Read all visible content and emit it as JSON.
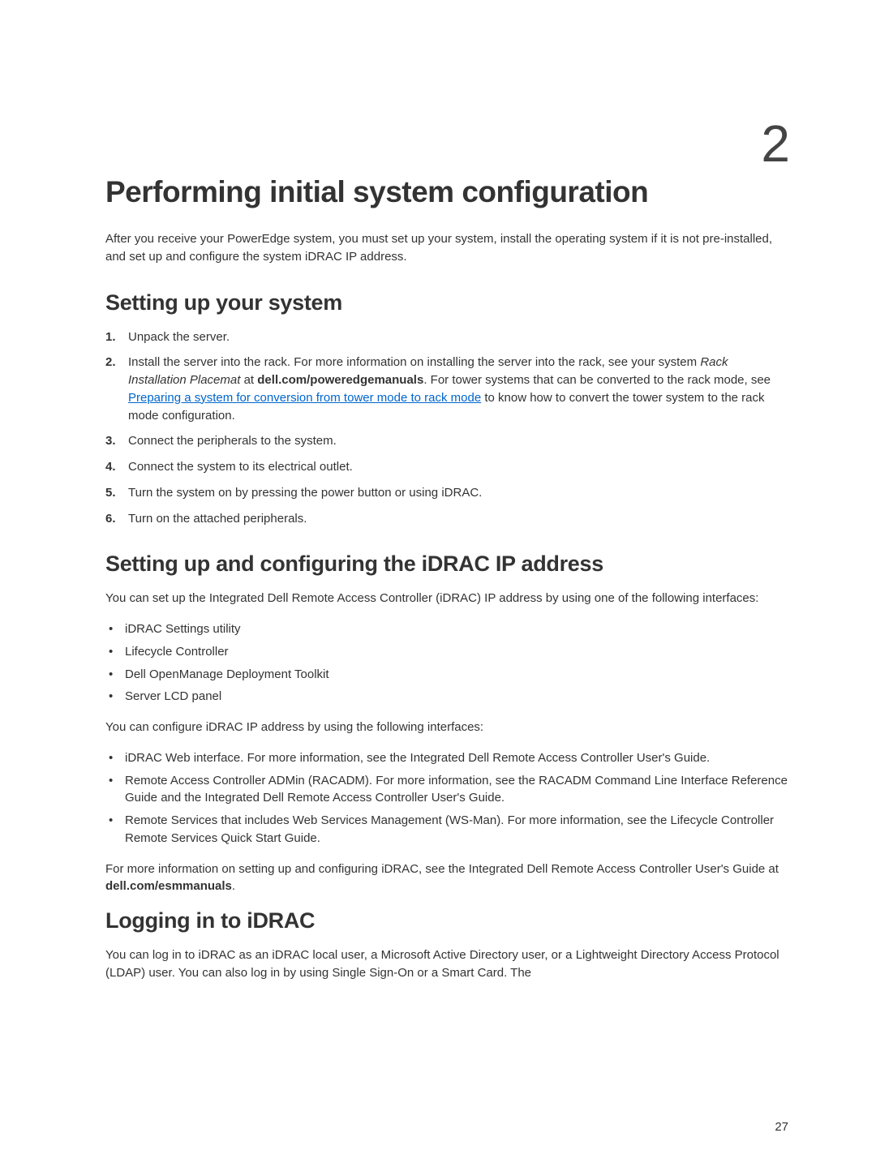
{
  "chapter": {
    "number": "2",
    "title": "Performing initial system configuration",
    "intro": "After you receive your PowerEdge system, you must set up your system, install the operating system if it is not pre-installed, and set up and configure the system iDRAC IP address."
  },
  "section1": {
    "heading": "Setting up your system",
    "steps": {
      "s1": {
        "num": "1.",
        "text": "Unpack the server."
      },
      "s2": {
        "num": "2.",
        "prefix": "Install the server into the rack. For more information on installing the server into the rack, see your system ",
        "italic": "Rack Installation Placemat",
        "mid1": " at ",
        "bold": "dell.com/poweredgemanuals",
        "mid2": ". For tower systems that can be converted to the rack mode, see ",
        "link": "Preparing a system for conversion from tower mode to rack mode",
        "suffix": " to know how to convert the tower system to the rack mode configuration."
      },
      "s3": {
        "num": "3.",
        "text": "Connect the peripherals to the system."
      },
      "s4": {
        "num": "4.",
        "text": "Connect the system to its electrical outlet."
      },
      "s5": {
        "num": "5.",
        "text": "Turn the system on by pressing the power button or using iDRAC."
      },
      "s6": {
        "num": "6.",
        "text": "Turn on the attached peripherals."
      }
    }
  },
  "section2": {
    "heading": "Setting up and configuring the iDRAC IP address",
    "intro": "You can set up the Integrated Dell Remote Access Controller (iDRAC) IP address by using one of the following interfaces:",
    "list1": {
      "i1": "iDRAC Settings utility",
      "i2": "Lifecycle Controller",
      "i3": "Dell OpenManage Deployment Toolkit",
      "i4": "Server LCD panel"
    },
    "mid": "You can configure iDRAC IP address by using the following interfaces:",
    "list2": {
      "i1": "iDRAC Web interface. For more information, see the Integrated Dell Remote Access Controller User's Guide.",
      "i2": "Remote Access Controller ADMin (RACADM). For more information, see the RACADM Command Line Interface Reference Guide and the Integrated Dell Remote Access Controller User's Guide.",
      "i3": "Remote Services that includes Web Services Management (WS-Man). For more information, see the Lifecycle Controller Remote Services Quick Start Guide."
    },
    "outro_prefix": "For more information on setting up and configuring iDRAC, see the Integrated Dell Remote Access Controller User's Guide at ",
    "outro_bold": "dell.com/esmmanuals",
    "outro_suffix": "."
  },
  "section3": {
    "heading": "Logging in to iDRAC",
    "text": "You can log in to iDRAC as an iDRAC local user, a Microsoft Active Directory user, or a Lightweight Directory Access Protocol (LDAP) user. You can also log in by using Single Sign-On or a Smart Card. The"
  },
  "page_number": "27"
}
